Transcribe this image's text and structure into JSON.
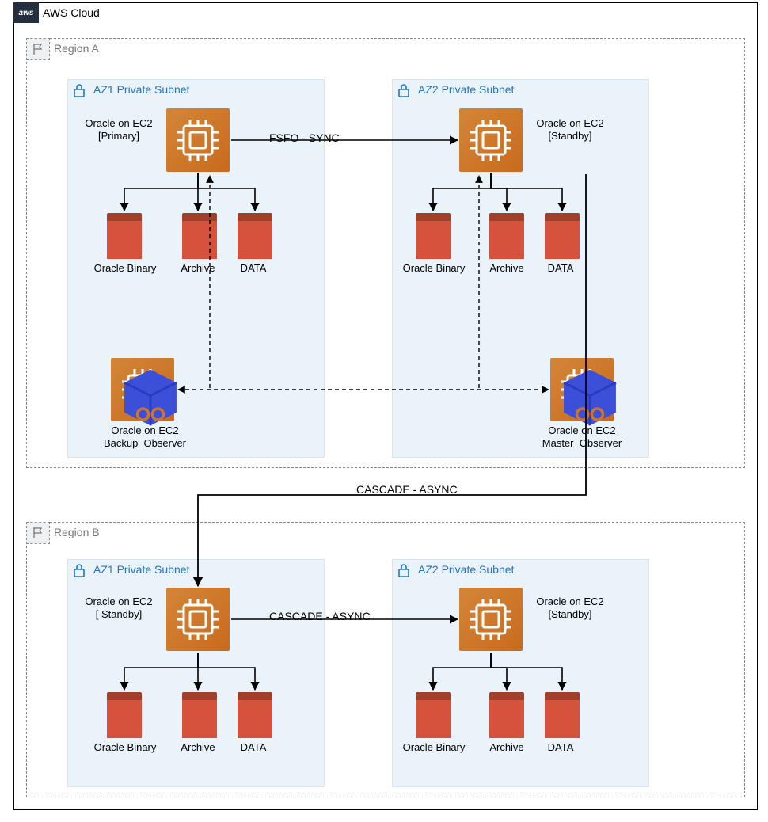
{
  "cloud": {
    "title": "AWS Cloud",
    "badge": "aws"
  },
  "regions": {
    "a": {
      "title": "Region A"
    },
    "b": {
      "title": "Region B"
    }
  },
  "subnets": {
    "a1": {
      "title": "AZ1 Private Subnet"
    },
    "a2": {
      "title": "AZ2 Private Subnet"
    },
    "b1": {
      "title": "AZ1 Private Subnet"
    },
    "b2": {
      "title": "AZ2 Private Subnet"
    }
  },
  "nodes": {
    "a1_ec2": {
      "label": "Oracle on EC2\n[Primary]"
    },
    "a2_ec2": {
      "label": "Oracle on EC2\n[Standby]"
    },
    "b1_ec2": {
      "label": "Oracle on EC2\n[ Standby]"
    },
    "b2_ec2": {
      "label": "Oracle on EC2\n[Standby]"
    },
    "a1_obs": {
      "label": "Oracle on EC2\nBackup  Observer"
    },
    "a2_obs": {
      "label": "Oracle on EC2\nMaster  Observer"
    }
  },
  "storage_labels": {
    "binary": "Oracle Binary",
    "archive": "Archive",
    "data": "DATA"
  },
  "connections": {
    "fsfo": "FSFO  - SYNC",
    "cascade1": "CASCADE - ASYNC",
    "cascade2": "CASCADE  - ASYNC"
  },
  "colors": {
    "subnet_bg": "#eaf3fa",
    "ec2_orange": "#d07327",
    "storage_red": "#d5533c",
    "accent_blue": "#1f77c9",
    "observer_cube": "#3b4fd8"
  }
}
